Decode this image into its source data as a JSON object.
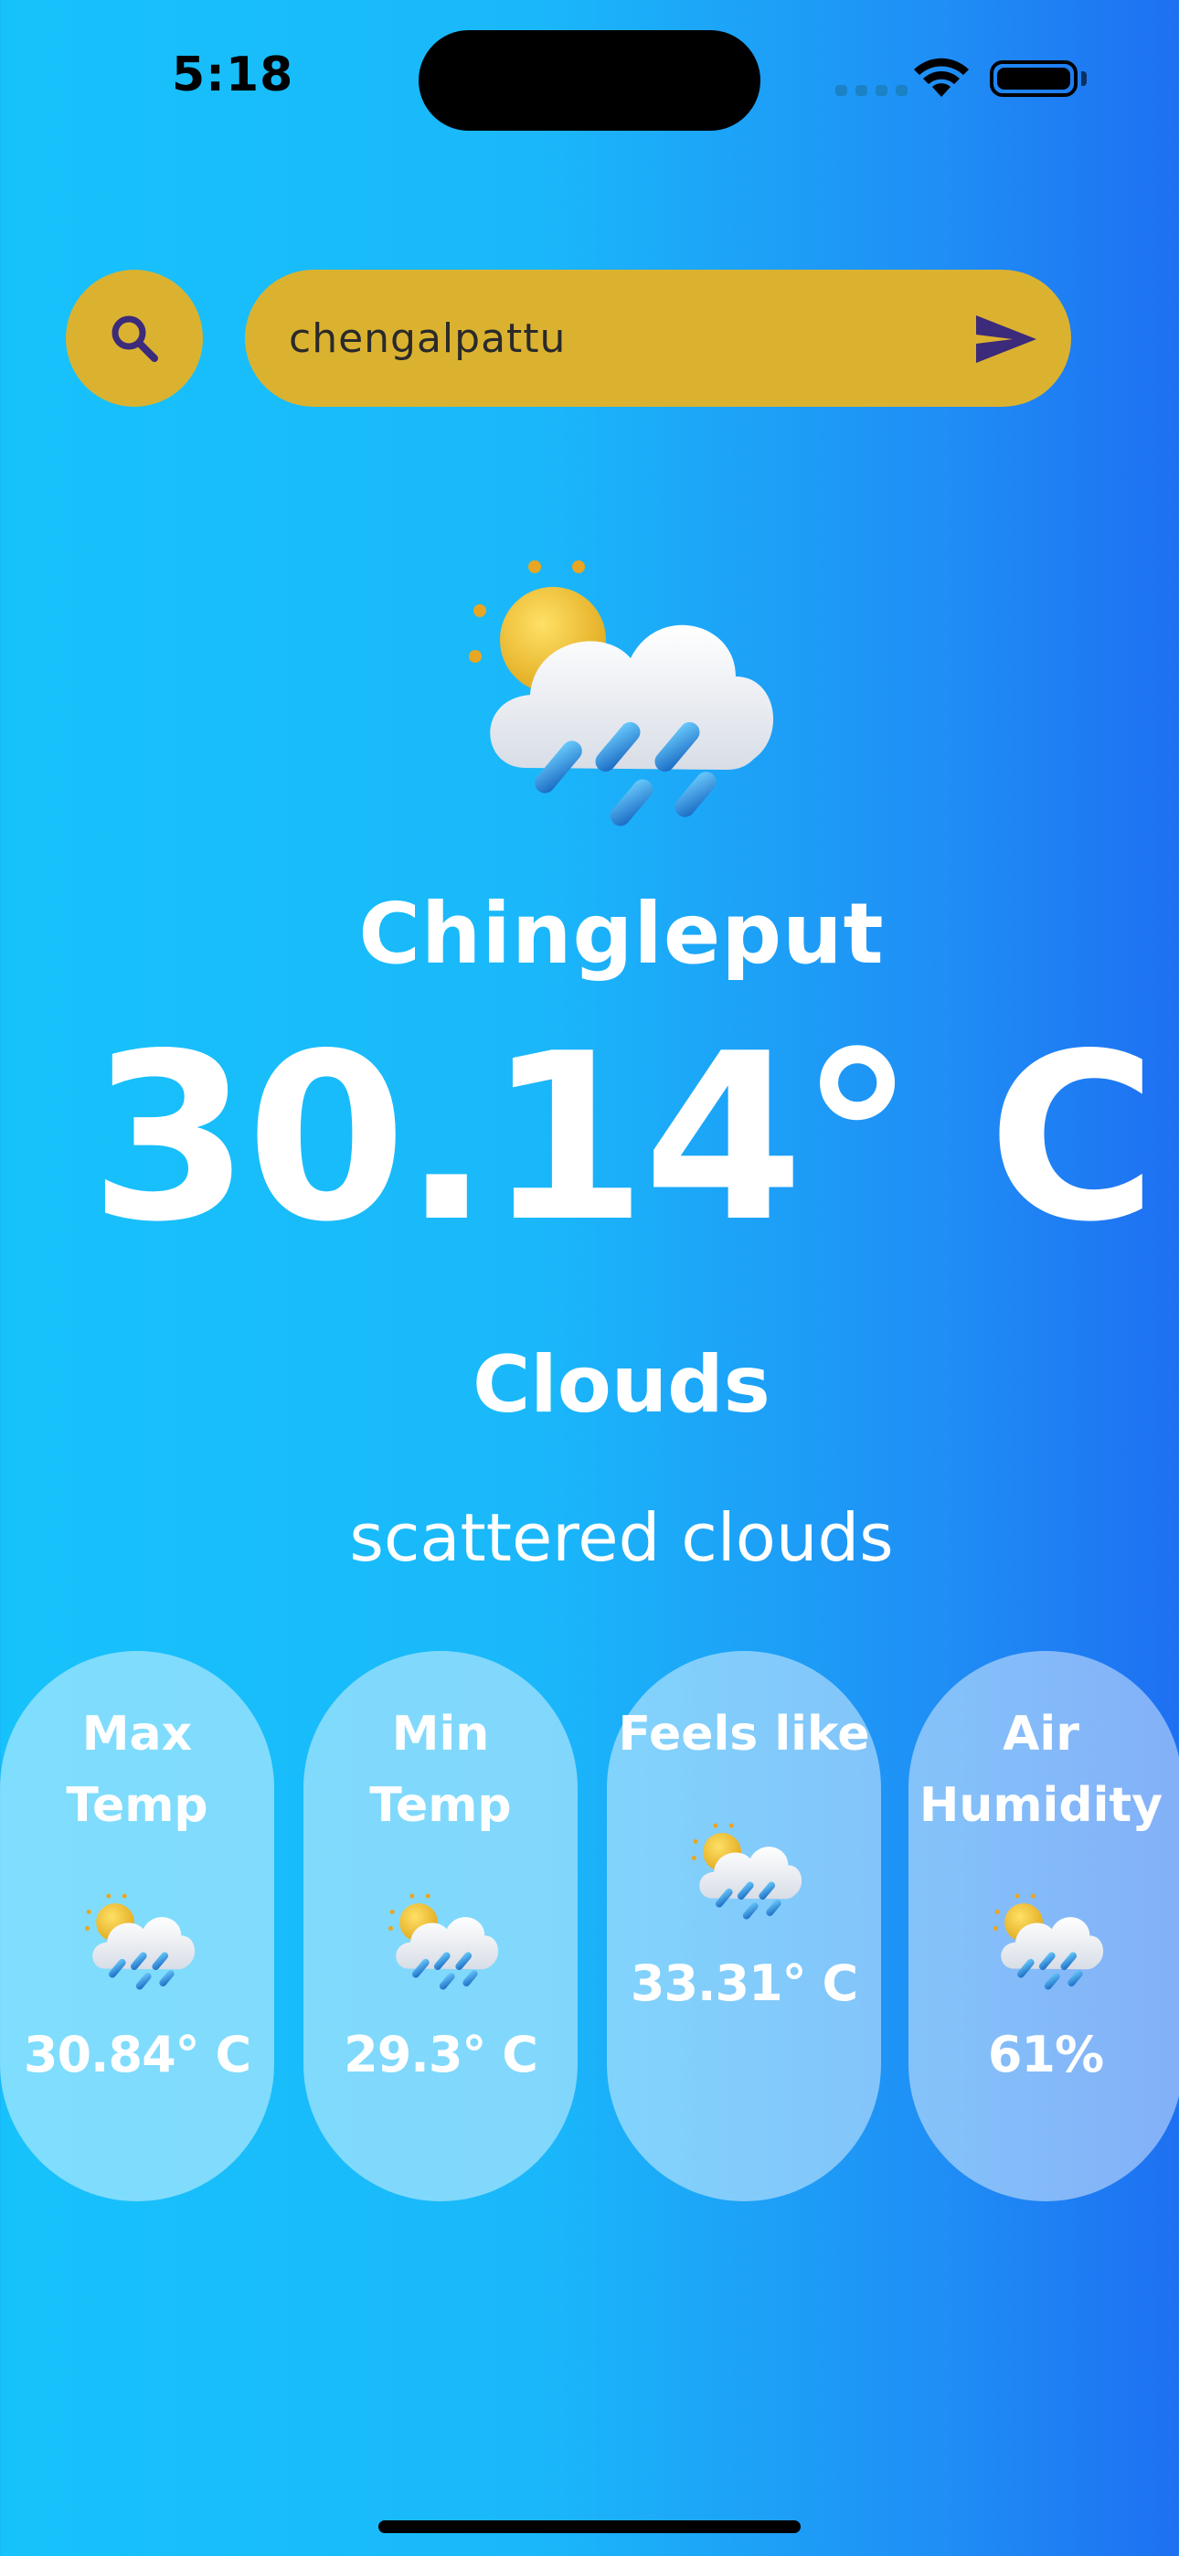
{
  "status_bar": {
    "time": "5:18"
  },
  "search": {
    "query": "chengalpattu"
  },
  "weather": {
    "city": "Chingleput",
    "temperature": "30.14° C",
    "condition": "Clouds",
    "description": "scattered clouds",
    "icon": "cloud-sun-rain-icon"
  },
  "cards": [
    {
      "label": "Max Temp",
      "value": "30.84° C",
      "icon": "cloud-sun-rain-icon"
    },
    {
      "label": "Min Temp",
      "value": "29.3° C",
      "icon": "cloud-sun-rain-icon"
    },
    {
      "label": "Feels like",
      "value": "33.31° C",
      "icon": "cloud-sun-rain-icon"
    },
    {
      "label": "Air Humidity",
      "value": "61%",
      "icon": "cloud-sun-rain-icon"
    }
  ],
  "colors": {
    "background_start": "#17c2fb",
    "background_end": "#1e70f2",
    "accent": "#dbb230",
    "icon": "#3c2a7a"
  }
}
